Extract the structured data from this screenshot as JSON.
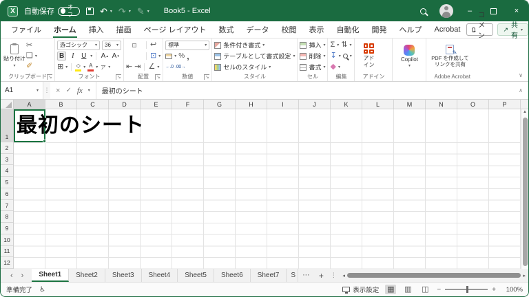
{
  "colors": {
    "titlebar_green": "#1a6b40",
    "accent_green": "#1a7340",
    "addin_red": "#d83b01",
    "fill_yellow": "#ffe812",
    "font_color_red": "#e03c31"
  },
  "icons": {
    "undo": "↶",
    "redo": "↷",
    "pen": "✎",
    "qat_dropdown": "▾",
    "scissors": "✂",
    "copy": "❏",
    "format_painter": "✐",
    "borders": "⊞",
    "fill_glyph": "◇",
    "font_color_glyph": "A",
    "ruby": "ァ",
    "wrap_text": "↩",
    "merge": "⊡",
    "indent_left": "⇤",
    "indent_right": "⇥",
    "orientation": "∠",
    "currency": "¥",
    "percent": "%",
    "comma": ",",
    "inc_decimal": "←.0",
    "dec_decimal": ".00→",
    "autosum": "Σ",
    "sort_filter": "⇅",
    "fill_down": "↧",
    "clear": "◆",
    "name_cancel": "×",
    "name_enter": "✓",
    "fx": "fx",
    "sheet_prev": "‹",
    "sheet_next": "›",
    "sheet_more": "⋯",
    "sheet_add": "+",
    "tab_splitter": "⋮",
    "accessibility": "♿",
    "normal_view": "▦",
    "page_layout_view": "▥",
    "page_break_view": "◫",
    "vscroll_up": "▲",
    "hscroll_left": "◂",
    "hscroll_right": "▸",
    "minimize": "–",
    "close": "×",
    "collapse_ribbon": "∨",
    "formula_expand": "∧"
  },
  "titlebar": {
    "autosave_label": "自動保存",
    "autosave_state": "オフ",
    "title": "Book5 - Excel"
  },
  "ribbon_tabs": {
    "items": [
      {
        "label": "ファイル"
      },
      {
        "label": "ホーム",
        "active": "true"
      },
      {
        "label": "挿入"
      },
      {
        "label": "描画"
      },
      {
        "label": "ページ レイアウト"
      },
      {
        "label": "数式"
      },
      {
        "label": "データ"
      },
      {
        "label": "校閲"
      },
      {
        "label": "表示"
      },
      {
        "label": "自動化"
      },
      {
        "label": "開発"
      },
      {
        "label": "ヘルプ"
      },
      {
        "label": "Acrobat"
      }
    ],
    "comment_label": "コメント",
    "share_label": "共有"
  },
  "ribbon": {
    "clipboard": {
      "label": "クリップボード",
      "paste_label": "貼り付け"
    },
    "font": {
      "label": "フォント",
      "font_name": "游ゴシック",
      "font_size": "36"
    },
    "alignment": {
      "label": "配置"
    },
    "number": {
      "label": "数値",
      "format": "標準"
    },
    "styles": {
      "label": "スタイル",
      "items": [
        "条件付き書式",
        "テーブルとして書式設定",
        "セルのスタイル"
      ]
    },
    "cells": {
      "label": "セル",
      "items": [
        "挿入",
        "削除",
        "書式"
      ]
    },
    "editing": {
      "label": "編集"
    },
    "addins": {
      "label": "アドイン",
      "button_label": "アドイン"
    },
    "copilot": {
      "label": "アドイン",
      "button_label": "Copilot"
    },
    "acrobat": {
      "label": "Adobe Acrobat",
      "button_label": "PDF を作成してリンクを共有"
    }
  },
  "formula_bar": {
    "name_box": "A1",
    "content": "最初のシート"
  },
  "grid": {
    "columns": [
      "A",
      "B",
      "C",
      "D",
      "E",
      "F",
      "G",
      "H",
      "I",
      "J",
      "K",
      "L",
      "M",
      "N",
      "O",
      "P"
    ],
    "rows": [
      "1",
      "2",
      "3",
      "4",
      "5",
      "6",
      "7",
      "8",
      "9",
      "10",
      "11",
      "12"
    ],
    "active_cell": "A1",
    "a1_text": "最初のシート"
  },
  "sheet_bar": {
    "tabs": [
      {
        "label": "Sheet1",
        "active": "true"
      },
      {
        "label": "Sheet2"
      },
      {
        "label": "Sheet3"
      },
      {
        "label": "Sheet4"
      },
      {
        "label": "Sheet5"
      },
      {
        "label": "Sheet6"
      },
      {
        "label": "Sheet7"
      }
    ],
    "partial_tab": "S"
  },
  "status_bar": {
    "ready": "準備完了",
    "display_settings": "表示設定",
    "zoom_level": "100%"
  }
}
